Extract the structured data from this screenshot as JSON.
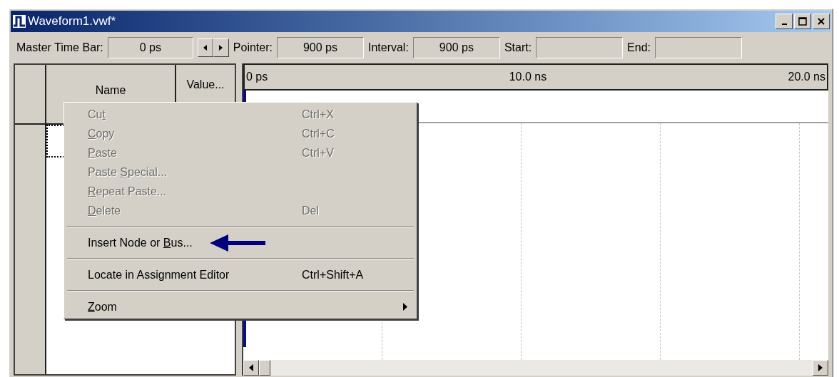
{
  "window": {
    "title": "Waveform1.vwf*"
  },
  "toolbar": [
    {
      "label": "Master Time Bar:",
      "value": "0 ps",
      "arrows": true
    },
    {
      "label": "Pointer:",
      "value": "900 ps"
    },
    {
      "label": "Interval:",
      "value": "900 ps"
    },
    {
      "label": "Start:"
    },
    {
      "label": "End:"
    }
  ],
  "node_table": {
    "columns": [
      "Name",
      "Value..."
    ]
  },
  "timeline": {
    "ticks": [
      "0 ps",
      "10.0 ns",
      "20.0 ns"
    ]
  },
  "context_menu": [
    {
      "kind": "item",
      "before": "Cu",
      "mnemonic": "t",
      "shortcut": "Ctrl+X",
      "disabled": true
    },
    {
      "kind": "item",
      "mnemonic": "C",
      "after": "opy",
      "shortcut": "Ctrl+C",
      "disabled": true
    },
    {
      "kind": "item",
      "mnemonic": "P",
      "after": "aste",
      "shortcut": "Ctrl+V",
      "disabled": true
    },
    {
      "kind": "item",
      "before": "Paste ",
      "mnemonic": "S",
      "after": "pecial...",
      "disabled": true
    },
    {
      "kind": "item",
      "mnemonic": "R",
      "after": "epeat Paste...",
      "disabled": true
    },
    {
      "kind": "item",
      "mnemonic": "D",
      "after": "elete",
      "shortcut": "Del",
      "disabled": true
    },
    {
      "kind": "separator"
    },
    {
      "kind": "item",
      "before": "Insert Node or ",
      "mnemonic": "B",
      "after": "us...",
      "disabled": false,
      "pointed": true
    },
    {
      "kind": "separator"
    },
    {
      "kind": "item",
      "before": "Locate in Assignment Editor",
      "shortcut": "Ctrl+Shift+A",
      "disabled": false
    },
    {
      "kind": "separator"
    },
    {
      "kind": "item",
      "mnemonic": "Z",
      "after": "oom",
      "disabled": false,
      "submenu": true
    }
  ]
}
